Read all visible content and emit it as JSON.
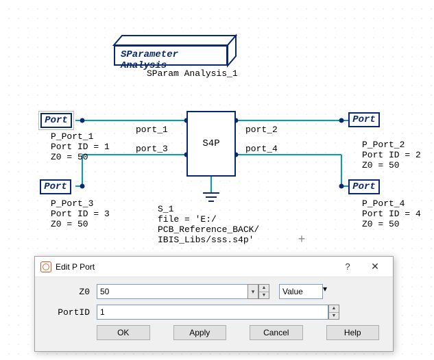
{
  "analysis": {
    "title": "SParameter Analysis",
    "instance": "SParam Analysis_1"
  },
  "s4p": {
    "label": "S4P",
    "instance": "S_1",
    "file_lines": "file = 'E:/\nPCB_Reference_BACK/\nIBIS_Libs/sss.s4p'",
    "port_labels": {
      "p1": "port_1",
      "p2": "port_2",
      "p3": "port_3",
      "p4": "port_4"
    }
  },
  "ports": {
    "port_label": "Port",
    "p1": {
      "name": "P_Port_1",
      "id_line": "Port ID = 1",
      "z_line": "Z0 = 50"
    },
    "p2": {
      "name": "P_Port_2",
      "id_line": "Port ID = 2",
      "z_line": "Z0 = 50"
    },
    "p3": {
      "name": "P_Port_3",
      "id_line": "Port ID = 3",
      "z_line": "Z0 = 50"
    },
    "p4": {
      "name": "P_Port_4",
      "id_line": "Port ID = 4",
      "z_line": "Z0 = 50"
    }
  },
  "dialog": {
    "title": "Edit P Port",
    "help_q": "?",
    "close_x": "✕",
    "z0_label": "Z0",
    "z0_value": "50",
    "value_combo": "Value",
    "portid_label": "PortID",
    "portid_value": "1",
    "buttons": {
      "ok": "OK",
      "apply": "Apply",
      "cancel": "Cancel",
      "help": "Help"
    }
  }
}
